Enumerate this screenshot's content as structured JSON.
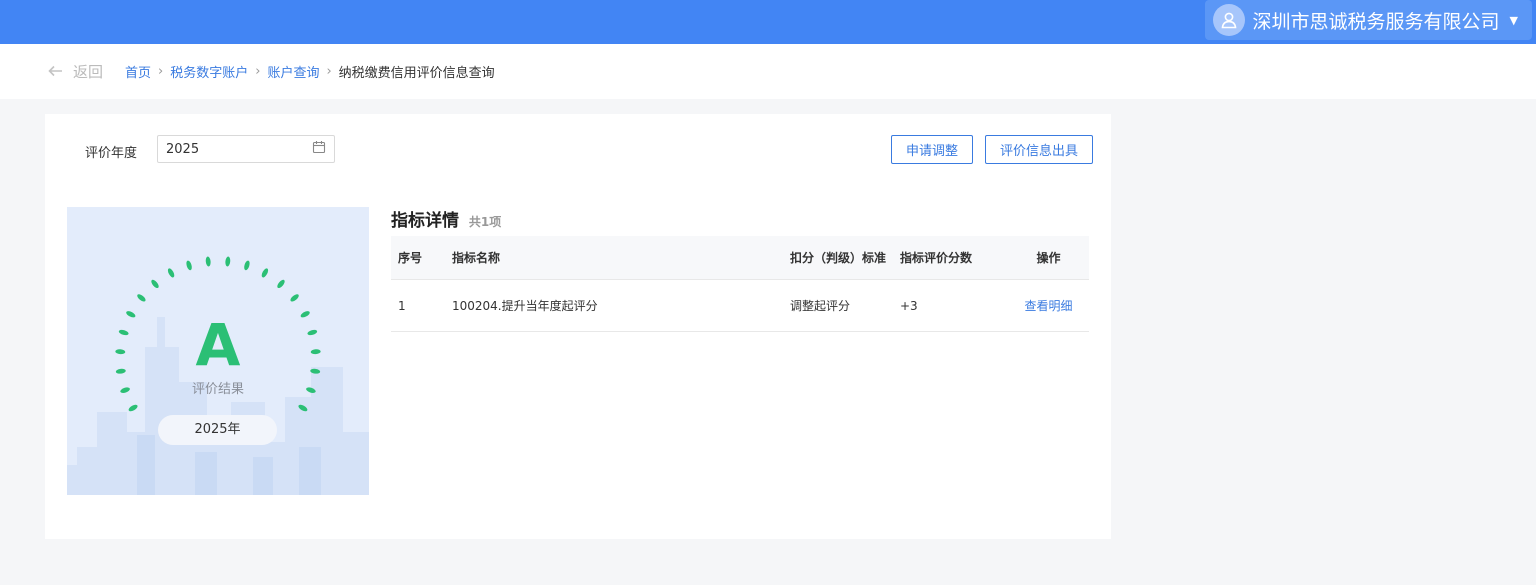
{
  "header": {
    "company_name": "深圳市思诚税务服务有限公司",
    "avatar_icon": "user-icon",
    "caret_icon": "caret-down-icon",
    "bg_color": "#4285f4"
  },
  "nav": {
    "back_label": "返回",
    "breadcrumbs": [
      "首页",
      "税务数字账户",
      "账户查询",
      "纳税缴费信用评价信息查询"
    ]
  },
  "filter": {
    "year_label": "评价年度",
    "year_value": "2025",
    "calendar_icon": "calendar-icon"
  },
  "actions": {
    "apply_adjust": "申请调整",
    "issue_info": "评价信息出具"
  },
  "result": {
    "grade": "A",
    "caption": "评价结果",
    "year": "2025年",
    "accent_color": "#2bbf75"
  },
  "detail": {
    "title": "指标详情",
    "count": "共1项",
    "columns": [
      "序号",
      "指标名称",
      "扣分（判级）标准",
      "指标评价分数",
      "操作"
    ],
    "rows": [
      {
        "index": "1",
        "name": "100204.提升当年度起评分",
        "standard": "调整起评分",
        "score": "+3",
        "action": "查看明细"
      }
    ]
  }
}
